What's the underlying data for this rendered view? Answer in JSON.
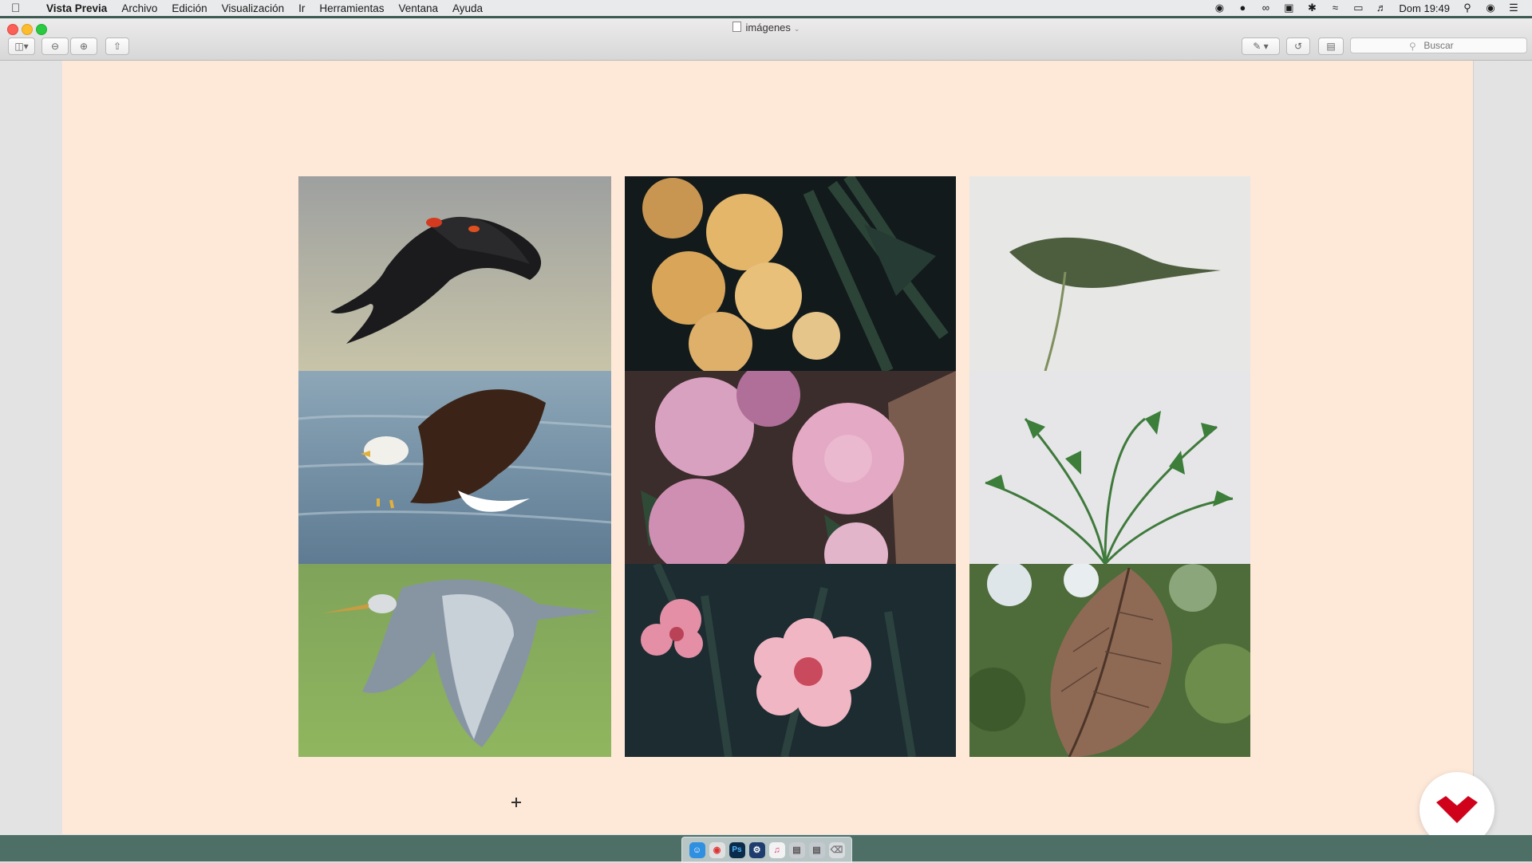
{
  "menubar": {
    "app_name": "Vista Previa",
    "items": [
      "Archivo",
      "Edición",
      "Visualización",
      "Ir",
      "Herramientas",
      "Ventana",
      "Ayuda"
    ],
    "clock": "Dom 19:49"
  },
  "window": {
    "title": "imágenes",
    "search_placeholder": "Buscar"
  },
  "photos": [
    {
      "subject": "red-winged blackbird in flight"
    },
    {
      "subject": "yellow tulips"
    },
    {
      "subject": "green leaf on white background"
    },
    {
      "subject": "african fish eagle over water"
    },
    {
      "subject": "pink peonies"
    },
    {
      "subject": "palm plant on white background"
    },
    {
      "subject": "grey heron in flight"
    },
    {
      "subject": "pink dianthus flowers"
    },
    {
      "subject": "dry brown leaf"
    }
  ],
  "colors": {
    "canvas": "#fee9d9",
    "brand_red": "#d0021b"
  }
}
